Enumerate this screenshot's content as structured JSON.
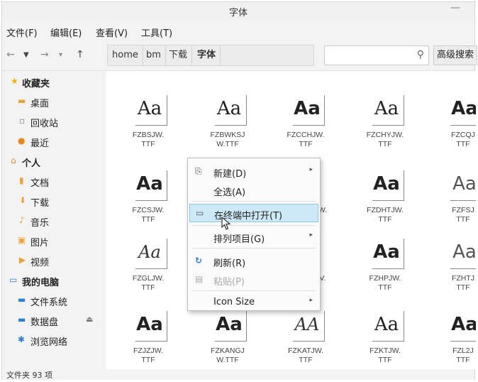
{
  "window": {
    "title": "字体"
  },
  "menubar": [
    "文件(F)",
    "编辑(E)",
    "查看(V)",
    "工具(T)"
  ],
  "toolbar": {
    "breadcrumbs": [
      "home",
      "bm",
      "下载",
      "字体"
    ],
    "search_placeholder": "",
    "advanced_search": "高级搜索"
  },
  "sidebar": {
    "favorites": {
      "header": "收藏夹",
      "items": [
        "桌面",
        "回收站",
        "最近"
      ]
    },
    "personal": {
      "header": "个人",
      "items": [
        "文档",
        "下载",
        "音乐",
        "图片",
        "视频"
      ]
    },
    "computer": {
      "header": "我的电脑",
      "items": [
        "文件系统",
        "数据盘",
        "浏览网络"
      ]
    }
  },
  "files": [
    {
      "name": "FZBSJW.\nTTF",
      "glyph": "Aa"
    },
    {
      "name": "FZBWKSJ\nW.TTF",
      "glyph": "Aa"
    },
    {
      "name": "FZCCHJW.\nTTF",
      "glyph": "Aa"
    },
    {
      "name": "FZCHYJW.\nTTF",
      "glyph": "Aa"
    },
    {
      "name": "FZCQJ\nTTF",
      "glyph": "Aa"
    },
    {
      "name": "FZCSJW.\nTTF",
      "glyph": "Aa"
    },
    {
      "name": "",
      "glyph": ""
    },
    {
      "name": "W.",
      "glyph": ""
    },
    {
      "name": "FZDHTJW.\nTTF",
      "glyph": "Aa"
    },
    {
      "name": "FZFSJ\nTTF",
      "glyph": "Aa"
    },
    {
      "name": "FZGLJW.\nTTF",
      "glyph": "Aa"
    },
    {
      "name": "",
      "glyph": ""
    },
    {
      "name": "V.",
      "glyph": ""
    },
    {
      "name": "FZHPJW.\nTTF",
      "glyph": "Aa"
    },
    {
      "name": "FZHTJ\nTTF",
      "glyph": "Aa"
    },
    {
      "name": "FZJZJW.\nTTF",
      "glyph": "Aa"
    },
    {
      "name": "FZKANGJ\nW.TTF",
      "glyph": "Aa"
    },
    {
      "name": "FZKATJW.\nTTF",
      "glyph": "AA"
    },
    {
      "name": "FZKTJW.\nTTF",
      "glyph": "Aa"
    },
    {
      "name": "FZL2J\nTTF",
      "glyph": "Aa"
    }
  ],
  "context_menu": {
    "new": "新建(D)",
    "select_all": "全选(A)",
    "open_terminal": "在终端中打开(T)",
    "sort": "排列项目(G)",
    "refresh": "刷新(R)",
    "paste": "粘贴(P)",
    "icon_size": "Icon Size"
  },
  "status": "文件夹 93 项",
  "colors": {
    "highlight": "#cde8f6",
    "accent_blue": "#2f80d0",
    "star": "#f0b400"
  }
}
